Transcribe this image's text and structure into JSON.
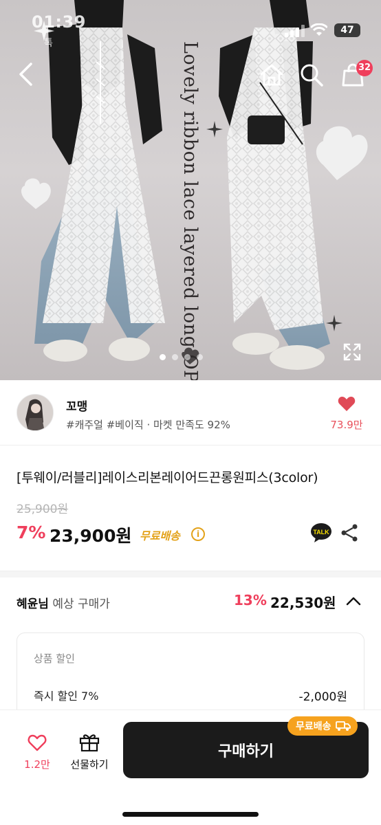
{
  "status_bar": {
    "time": "01:39",
    "sub": "톡",
    "battery": "47"
  },
  "hero": {
    "overlay_text": "Lovely ribbon lace layered long OPS",
    "cart_count": "32",
    "page_count": 4,
    "active_page": 0
  },
  "seller": {
    "name": "꼬맹",
    "meta": "#캐주얼 #베이직 · 마켓 만족도 92%",
    "like_count": "73.9만"
  },
  "product": {
    "title": "[투웨이/러블리]레이스리본레이어드끈롱원피스(3color)",
    "original_price": "25,900원",
    "discount": "7%",
    "price": "23,900원",
    "shipping": "무료배송",
    "info_glyph": "i"
  },
  "expected": {
    "user": "혜윤님",
    "label": " 예상 구매가",
    "discount": "13%",
    "price": "22,530원"
  },
  "breakdown": {
    "heading": "상품 할인",
    "rows": [
      {
        "label": "즉시 할인 7%",
        "value": "-2,000원"
      }
    ]
  },
  "bottom_bar": {
    "like_count": "1.2만",
    "gift_label": "선물하기",
    "buy_label": "구매하기",
    "shipping_pill": "무료배송"
  },
  "colors": {
    "accent": "#ef3f5c",
    "shipping": "#e3a21a",
    "buy_button": "#1b1b1b",
    "pill": "#f6a21e"
  }
}
